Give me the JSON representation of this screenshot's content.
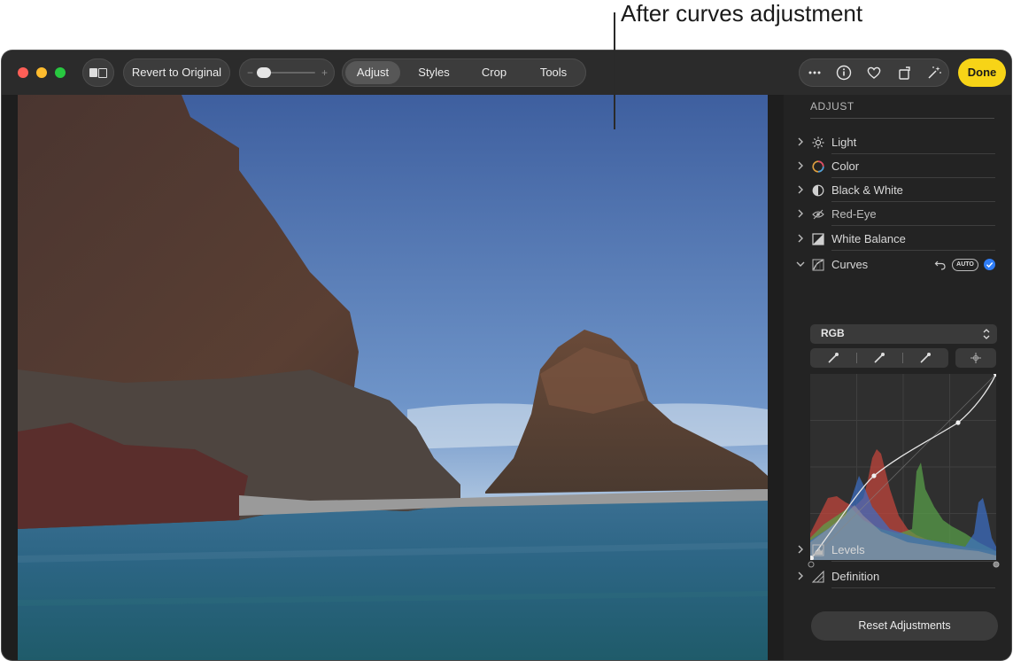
{
  "callout": {
    "text": "After curves adjustment"
  },
  "toolbar": {
    "revert_label": "Revert to Original",
    "slider_minus": "−",
    "slider_plus": "+",
    "tabs": [
      {
        "label": "Adjust",
        "active": true
      },
      {
        "label": "Styles",
        "active": false
      },
      {
        "label": "Crop",
        "active": false
      },
      {
        "label": "Tools",
        "active": false
      }
    ],
    "right_icons": [
      "more-icon",
      "info-icon",
      "heart-icon",
      "rotate-icon",
      "magic-wand-icon"
    ],
    "done_label": "Done"
  },
  "sidebar": {
    "header": "ADJUST",
    "sections": [
      {
        "label": "Light",
        "icon": "sun-icon"
      },
      {
        "label": "Color",
        "icon": "color-wheel-icon"
      },
      {
        "label": "Black & White",
        "icon": "half-circle-icon"
      },
      {
        "label": "Red-Eye",
        "icon": "eye-icon"
      },
      {
        "label": "White Balance",
        "icon": "white-balance-icon"
      },
      {
        "label": "Curves",
        "icon": "curves-icon",
        "expanded": true
      },
      {
        "label": "Levels",
        "icon": "levels-icon"
      },
      {
        "label": "Definition",
        "icon": "definition-icon"
      }
    ],
    "curves": {
      "auto_label": "AUTO",
      "channel": "RGB",
      "enabled": true
    },
    "reset_label": "Reset Adjustments"
  },
  "colors": {
    "accent_done": "#f7d417",
    "check_blue": "#2f7df6",
    "traffic_red": "#fe5f57",
    "traffic_yellow": "#febc2e",
    "traffic_green": "#28c840"
  }
}
